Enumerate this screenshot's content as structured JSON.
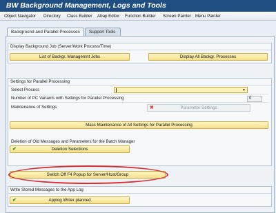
{
  "window": {
    "title": "BW Background Management, Logs and Tools"
  },
  "menu": {
    "items": [
      "Object Navigator",
      "Directory",
      "Class Builder",
      "Abap Editor",
      "Function Builder",
      "Screen Painter",
      "Menu Painter"
    ]
  },
  "tabs": [
    {
      "label": "Background and Parallel Processes",
      "active": true
    },
    {
      "label": "Support Tools",
      "active": false
    }
  ],
  "groups": {
    "background": {
      "title": "Display Background Job (Server/Work Process/Time)",
      "list_button": "List of Backgr. Managemnt Jobs",
      "display_button": "Display All Backgr. Processes"
    },
    "parallel": {
      "title": "Settings for Parallel Processing",
      "select_process_label": "Select Process",
      "select_process_value": "",
      "variants_label": "Number of PC Variants with Settings for Parallel Processing",
      "variants_value": "0",
      "maintenance_label": "Maintenance of Settings",
      "parameter_button": "Parameter Settings",
      "mass_button": "Mass Maintenance of All Settings for Parallel Processing",
      "deletion_label": "Deletion of Old Messages and Parameters for the Batch Manager",
      "deletion_button": "Deletion Selections",
      "f4_button": "Switch Off F4 Popup for Server/Host/Group"
    },
    "applog": {
      "title": "Write Stored Messages to the App Log",
      "writer_button": "Applog Writer planned"
    }
  },
  "colors": {
    "title_bar": "#1f4f82",
    "button_yellow": "#f4e08c",
    "highlight": "#d62f2f",
    "check": "#2e8b1f"
  },
  "icons": {
    "check": "check-icon",
    "cancel": "cancel-x-icon",
    "dropdown": "dropdown-caret-icon"
  }
}
